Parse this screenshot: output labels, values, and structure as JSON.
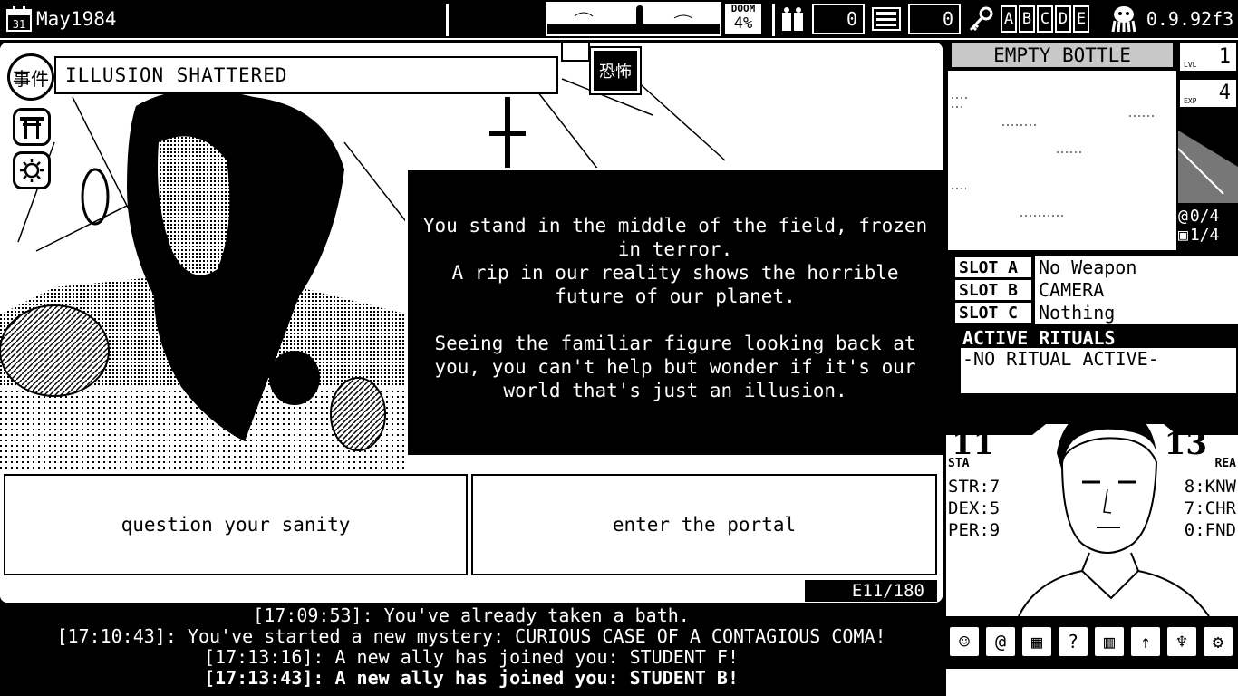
{
  "topbar": {
    "calendar_day": "31",
    "date": "May1984",
    "doom_label": "DOOM",
    "doom_value": "4%",
    "counter_1": "0",
    "counter_2": "0",
    "keys": [
      "A",
      "B",
      "C",
      "D",
      "E"
    ],
    "version": "0.9.92f3"
  },
  "event": {
    "badge": "事件",
    "title": "ILLUSION SHATTERED",
    "sign": "恐怖",
    "narrative_1": "You stand in the middle of the field, frozen in terror.",
    "narrative_2": "A rip in our reality shows the horrible future of our planet.",
    "narrative_3": "Seeing the familiar figure looking back at you, you can't help but wonder if it's our world that's just an illusion.",
    "choices": [
      "question your sanity",
      "enter the portal"
    ],
    "turn": "E11/180"
  },
  "log": [
    "[17:09:53]: You've already taken a bath.",
    "[17:10:43]: You've started a new mystery: CURIOUS CASE OF A CONTAGIOUS COMA!",
    "[17:13:16]: A new ally has joined you: STUDENT F!",
    "[17:13:43]: A new ally has joined you: STUDENT B!"
  ],
  "inventory": {
    "item_name": "EMPTY BOTTLE",
    "lvl_label": "LVL",
    "lvl_value": "1",
    "exp_label": "EXP",
    "exp_value": "4",
    "spell_count": "0/4",
    "item_count": "1/4"
  },
  "slots": [
    {
      "label": "SLOT A",
      "value": "No Weapon"
    },
    {
      "label": "SLOT B",
      "value": "CAMERA"
    },
    {
      "label": "SLOT C",
      "value": "Nothing"
    }
  ],
  "rituals": {
    "header": "ACTIVE RITUALS",
    "status": "-NO RITUAL ACTIVE-"
  },
  "character": {
    "stamina": "11",
    "stamina_label": "STA",
    "reason": "13",
    "reason_label": "REA",
    "str": "STR:7",
    "dex": "DEX:5",
    "per": "PER:9",
    "knw": "8:KNW",
    "chr": "7:CHR",
    "fnd": "0:FND"
  },
  "colors": {
    "ink": "#000000",
    "paper": "#ffffff"
  }
}
